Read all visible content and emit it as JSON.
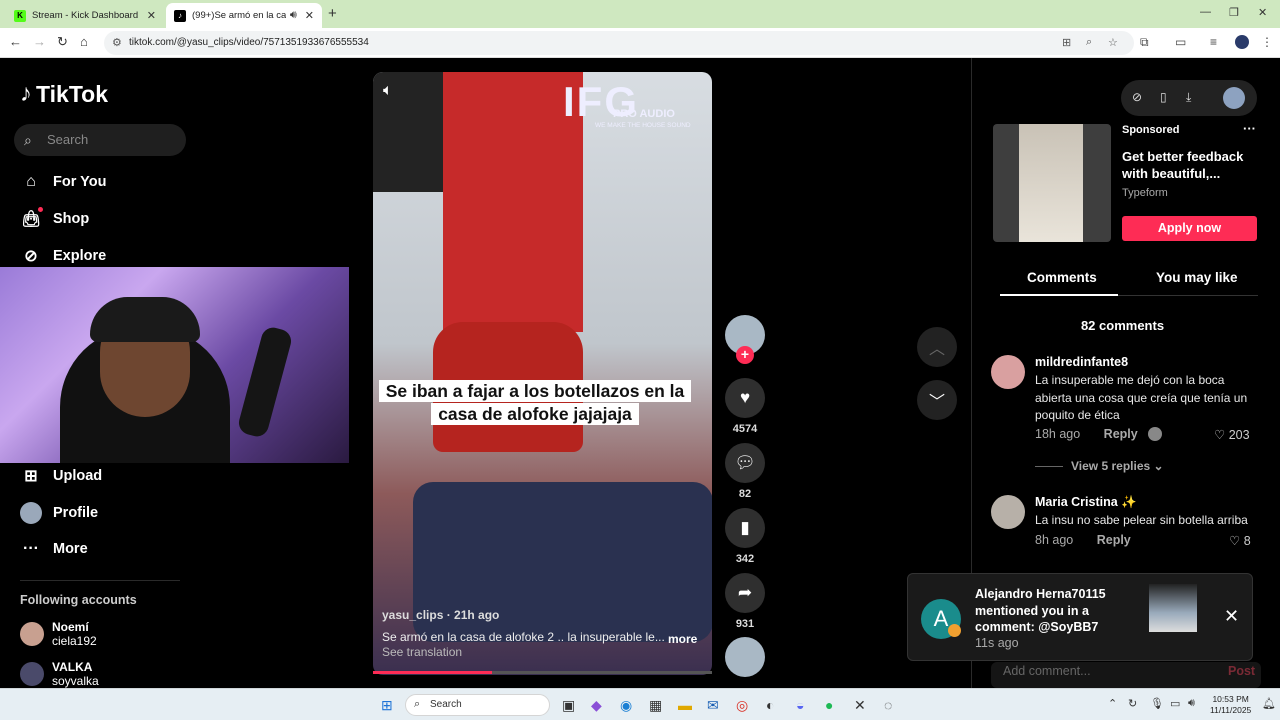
{
  "browser": {
    "tabs": [
      {
        "title": "Stream - Kick Dashboard",
        "favicon": "K"
      },
      {
        "title": "(99+)Se armó en la casa de",
        "favicon": "♪"
      }
    ],
    "url": "tiktok.com/@yasu_clips/video/7571351933676555534"
  },
  "sidebar": {
    "logo": "TikTok",
    "search_placeholder": "Search",
    "nav": [
      {
        "label": "For You",
        "icon": "home-icon"
      },
      {
        "label": "Shop",
        "icon": "bag-icon"
      },
      {
        "label": "Explore",
        "icon": "compass-icon"
      },
      {
        "label": "Upload",
        "icon": "plus-icon"
      },
      {
        "label": "Profile",
        "icon": "profile-icon"
      },
      {
        "label": "More",
        "icon": "more-icon"
      }
    ],
    "following_header": "Following accounts",
    "following": [
      {
        "display": "Noemí",
        "handle": "ciela192"
      },
      {
        "display": "VALKA",
        "handle": "soyvalka"
      }
    ]
  },
  "video": {
    "caption": "Se iban a fajar a los botellazos en la casa de alofoke jajajaja",
    "brand": "IFG",
    "brand_sub": "PRO AUDIO",
    "brand_tagline": "WE MAKE THE HOUSE SOUND",
    "author_line": "yasu_clips · 21h ago",
    "description": "Se armó en la casa de alofoke 2 .. la insuperable le...",
    "more": "more",
    "see_translation": "See translation",
    "progress": 0.35
  },
  "actions": {
    "likes": "4574",
    "comments": "82",
    "saves": "342",
    "shares": "931"
  },
  "ad": {
    "sponsored": "Sponsored",
    "headline": "Get better feedback with beautiful,...",
    "brand": "Typeform",
    "cta": "Apply now"
  },
  "panel": {
    "tabs": [
      "Comments",
      "You may like"
    ],
    "comment_count": "82 comments",
    "reply": "Reply",
    "view_replies": "View 5 replies",
    "comments": [
      {
        "name": "mildredinfante8",
        "text": "La insuperable me dejó con la boca abierta una cosa que creía que tenía un poquito de ética",
        "time": "18h ago",
        "likes": "203"
      },
      {
        "name": "Maria Cristina ✨",
        "text": "La insu no sabe pelear sin botella arriba",
        "time": "8h ago",
        "likes": "8"
      }
    ],
    "add_comment_placeholder": "Add comment...",
    "post": "Post"
  },
  "notification": {
    "avatar_letter": "A",
    "title": "Alejandro Herna70115 mentioned you in a comment: @SoyBB7",
    "time": "11s ago"
  },
  "taskbar": {
    "search": "Search",
    "time": "10:53 PM",
    "date": "11/11/2025"
  }
}
